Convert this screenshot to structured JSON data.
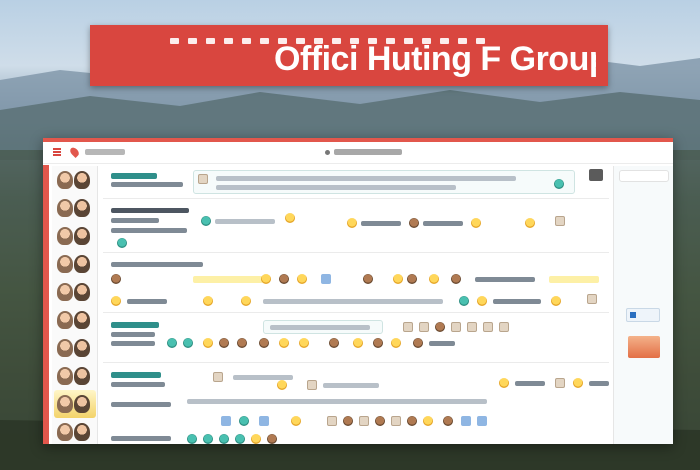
{
  "banner": {
    "title_visible_latin": "Offici Huting F Group"
  },
  "window": {
    "title": ""
  },
  "colors": {
    "accent": "#d9463f",
    "banner_bg": "#d9463f",
    "window_border": "#e2574c",
    "teal_text": "#2f8f8a",
    "highlight": "#fdf0a6"
  },
  "icons": {
    "menu": "menu-icon",
    "location": "pin-icon",
    "emoji": "emoji-icon",
    "avatar": "avatar"
  }
}
